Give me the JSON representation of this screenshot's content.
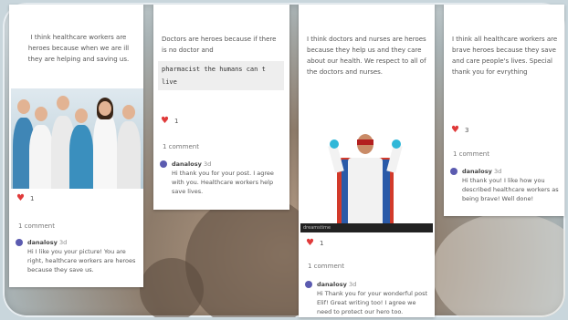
{
  "cards": [
    {
      "post": "I think healthcare workers are heroes because when we are ill they are helping and saving us.",
      "image_icon": "medical-team-photo",
      "likes": "1",
      "comments_label": "1 comment",
      "comment": {
        "author": "danalosy",
        "time": "3d",
        "text": "Hi        I like you your picture! You are right, healthcare workers are heroes because they save us."
      }
    },
    {
      "post": "Doctors are heroes because if there is no doctor and",
      "post_code": "pharmacist  the humans can t live",
      "likes": "1",
      "comments_label": "1 comment",
      "comment": {
        "author": "danalosy",
        "time": "3d",
        "text": "Hi        thank you for your post. I agree with you. Healthcare workers help save lives."
      }
    },
    {
      "post": "I think doctors and nurses are heroes because they help us and they care about our health. We respect to all of the doctors and nurses.",
      "image_icon": "superhero-doctor-photo",
      "image_caption": "dreamstime",
      "likes": "1",
      "comments_label": "1 comment",
      "comment": {
        "author": "danalosy",
        "time": "3d",
        "text": "Hi        Thank you for your wonderful post Elif! Great writing too! I agree we need to protect our hero too."
      }
    },
    {
      "post": "I think all healthcare workers are brave heroes because they save and care people's lives. Special thank you for evrything",
      "post_tail": "thing.",
      "likes": "3",
      "comments_label": "1 comment",
      "comment": {
        "author": "danalosy",
        "time": "3d",
        "text": "Hi        thank you! I like how you described healthcare workers as being brave! Well done!"
      }
    }
  ]
}
